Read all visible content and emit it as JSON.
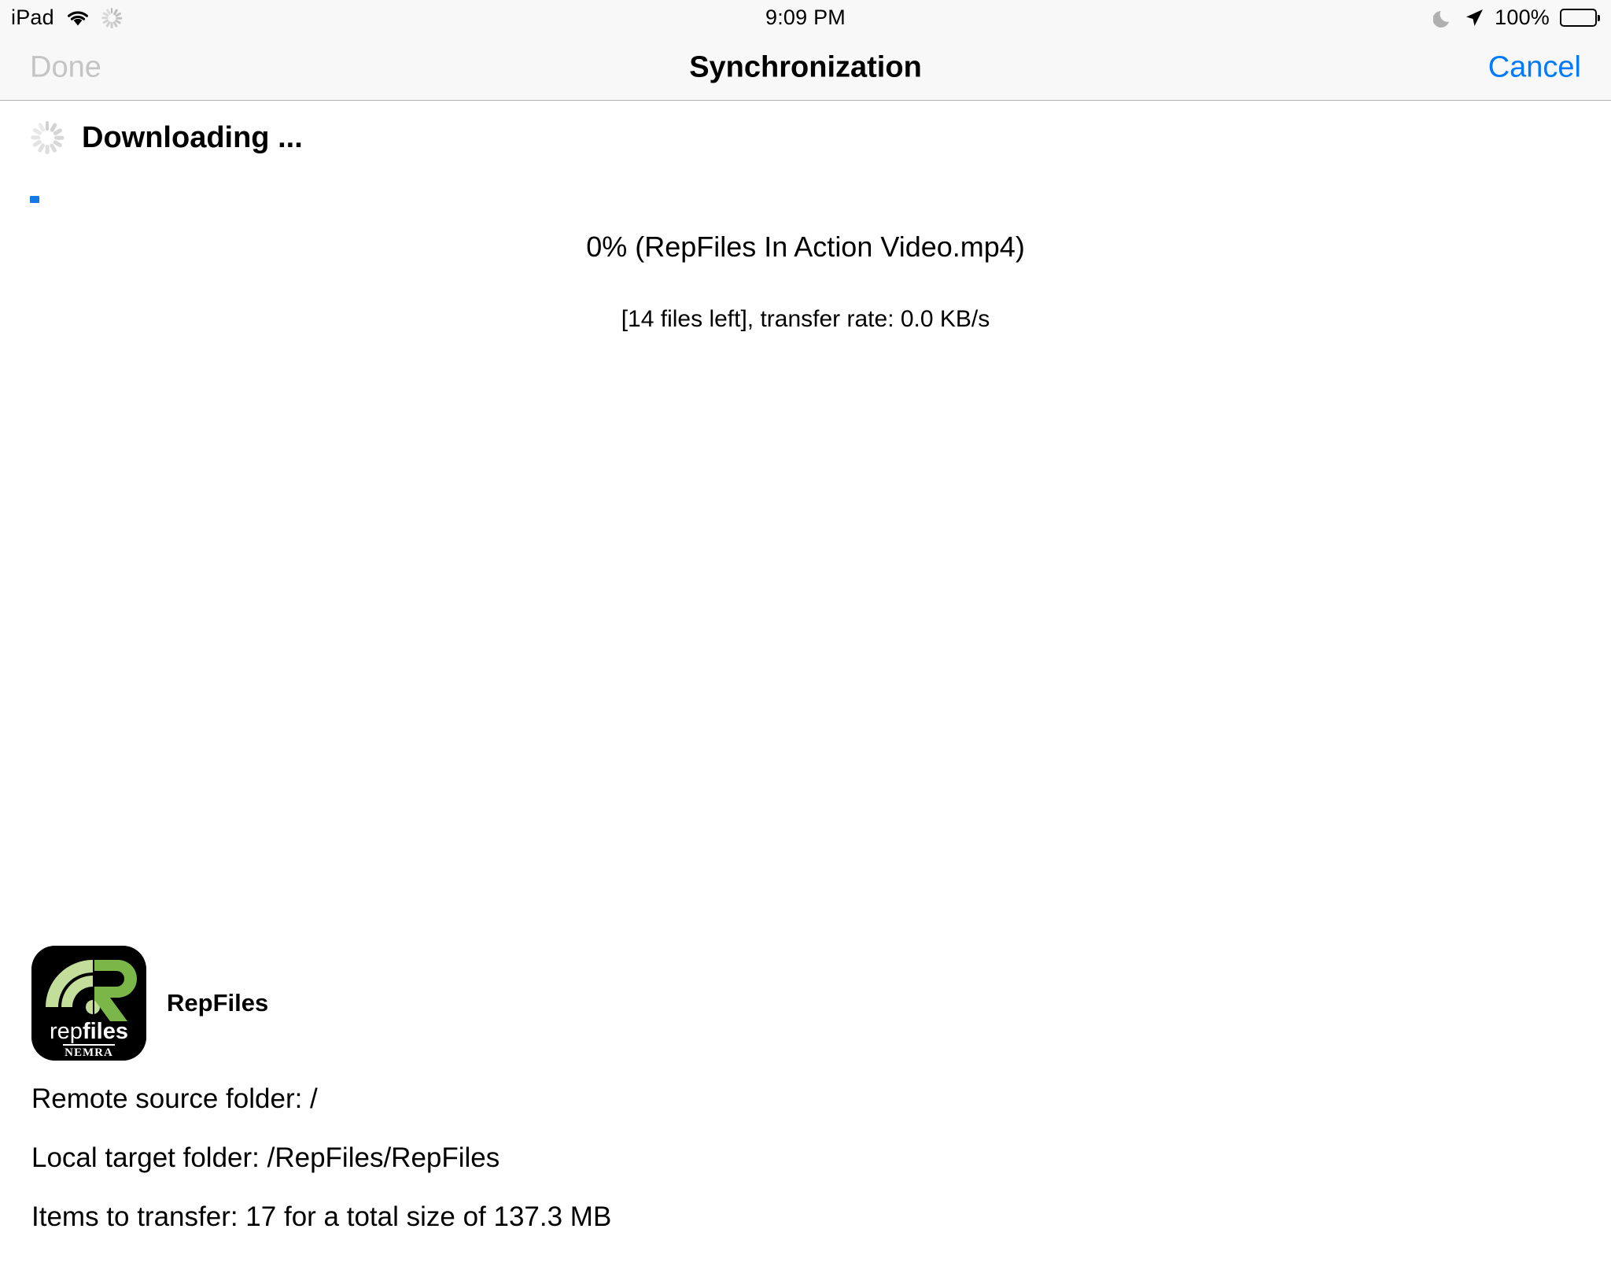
{
  "status_bar": {
    "device": "iPad",
    "wifi_icon": "wifi-icon",
    "activity_icon": "activity-spinner-icon",
    "time": "9:09 PM",
    "dnd_icon": "moon-icon",
    "location_icon": "location-arrow-icon",
    "battery_percent": "100%",
    "battery_icon": "battery-full-icon"
  },
  "nav_bar": {
    "done_label": "Done",
    "title": "Synchronization",
    "cancel_label": "Cancel",
    "done_enabled": false,
    "cancel_color": "#007aff",
    "disabled_color": "#c4c4c4"
  },
  "transfer": {
    "state_label": "Downloading ...",
    "spinner_icon": "activity-spinner-icon",
    "progress_percent": 0,
    "progress_color": "#1579e8",
    "percent_line": "0% (RepFiles In Action Video.mp4)",
    "files_line": "[14 files left], transfer rate: 0.0 KB/s"
  },
  "app": {
    "icon_name": "repfiles-app-icon",
    "icon_wordmark_top": "rep",
    "icon_wordmark_bold": "files",
    "icon_wordmark_bottom": "NEMRA",
    "name": "RepFiles",
    "icon_colors": {
      "background": "#000000",
      "wave_light": "#c3dd9a",
      "wave_mid": "#a9cf78",
      "letter_green": "#7ab648"
    }
  },
  "details": {
    "remote_source": "Remote source folder: /",
    "local_target": "Local target folder: /RepFiles/RepFiles",
    "items": "Items to transfer: 17 for a total size of 137.3 MB"
  }
}
